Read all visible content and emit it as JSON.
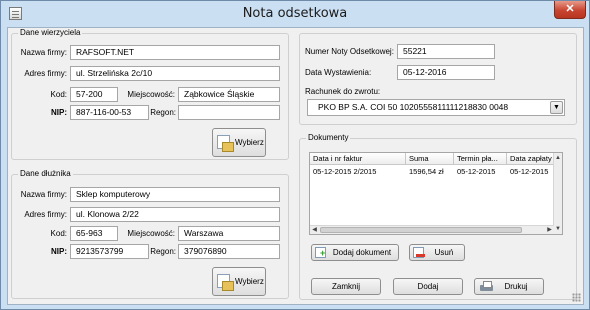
{
  "window": {
    "title": "Nota odsetkowa",
    "close_label": "✕"
  },
  "creditor": {
    "group_title": "Dane wierzyciela",
    "labels": {
      "company": "Nazwa firmy:",
      "address": "Adres firmy:",
      "postcode": "Kod:",
      "city": "Miejscowość:",
      "nip": "NIP:",
      "regon": "Regon:"
    },
    "values": {
      "company": "RAFSOFT.NET",
      "address": "ul. Strzelińska 2c/10",
      "postcode": "57-200",
      "city": "Ząbkowice Śląskie",
      "nip": "887-116-00-53",
      "regon": ""
    },
    "select_button": "Wybierz"
  },
  "debtor": {
    "group_title": "Dane dłużnika",
    "labels": {
      "company": "Nazwa firmy:",
      "address": "Adres firmy:",
      "postcode": "Kod:",
      "city": "Miejscowość:",
      "nip": "NIP:",
      "regon": "Regon:"
    },
    "values": {
      "company": "Sklep komputerowy",
      "address": "ul. Klonowa 2/22",
      "postcode": "65-963",
      "city": "Warszawa",
      "nip": "9213573799",
      "regon": "379076890"
    },
    "select_button": "Wybierz"
  },
  "note": {
    "number_label": "Numer Noty Odsetkowej:",
    "number_value": "55221",
    "date_label": "Data Wystawienia:",
    "date_value": "05-12-2016",
    "account_label": "Rachunek do zwrotu:",
    "account_value": "PKO BP S.A. COI 50 1020555811111218830 0048"
  },
  "documents": {
    "group_title": "Dokumenty",
    "columns": [
      "Data i nr faktur",
      "Suma",
      "Termin pła...",
      "Data zapłaty"
    ],
    "rows": [
      [
        "05-12-2015 2/2015",
        "1596,54 zł",
        "05-12-2015",
        "05-12-2015"
      ]
    ],
    "add_button": "Dodaj dokument",
    "remove_button": "Usuń"
  },
  "footer": {
    "close_button": "Zamknij",
    "add_button": "Dodaj",
    "print_button": "Drukuj"
  },
  "colors": {
    "window_frame": "#cbdff3",
    "client_bg": "#f0f0f0",
    "close_red": "#c74531"
  }
}
